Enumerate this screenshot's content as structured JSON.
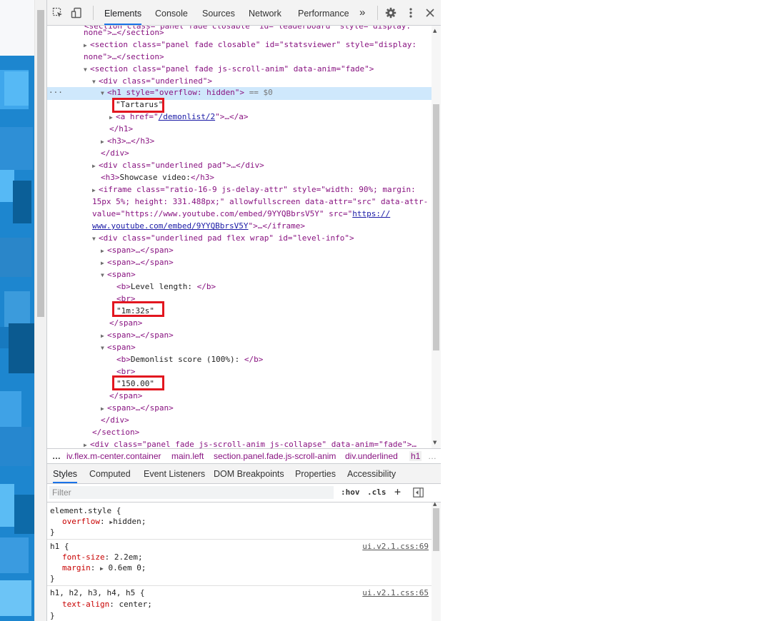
{
  "toolbar": {
    "tabs": [
      {
        "label": "Elements"
      },
      {
        "label": "Console"
      },
      {
        "label": "Sources"
      },
      {
        "label": "Network"
      },
      {
        "label": "Performance"
      }
    ],
    "more_label": "»",
    "settings_icon": "gear-icon",
    "menu_icon": "vertical-dots-icon",
    "close_icon": "close-icon"
  },
  "tree": {
    "lines": [
      {
        "a": "none\">…</section>"
      },
      {
        "a": "<section class=\"panel fade closable\" id=\"statsviewer\" style=\"display:"
      },
      {
        "a": "none\">…</section>"
      },
      {
        "a": "<section class=\"panel fade js-scroll-anim\" data-anim=\"fade\">"
      },
      {
        "a": "<div class=\"underlined\">"
      },
      {
        "a": "<h1 style=\"overflow: hidden\">",
        "b": "== $0"
      },
      {
        "a": "\"Tartarus\""
      },
      {
        "a": "<a href=\"",
        "link": "/demonlist/2",
        "c": "\">…</a>"
      },
      {
        "a": "</h1>"
      },
      {
        "a": "<h3>…</h3>"
      },
      {
        "a": "</div>"
      },
      {
        "a": "<div class=\"underlined pad\">…</div>"
      },
      {
        "a": "<h3>",
        "t": "Showcase video:",
        "c": "</h3>"
      },
      {
        "a": "<iframe class=\"ratio-16-9 js-delay-attr\" style=\"width: 90%; margin:"
      },
      {
        "a": "15px 5%; height: 331.488px;\" allowfullscreen data-attr=\"src\" data-attr-"
      },
      {
        "a": "value=\"https://www.youtube.com/embed/9YYQBbrsV5Y\" src=\"",
        "link": "https://"
      },
      {
        "link": "www.youtube.com/embed/9YYQBbrsV5Y",
        "c": "\">…</iframe>"
      },
      {
        "a": "<div class=\"underlined pad flex wrap\" id=\"level-info\">"
      },
      {
        "a": "<span>…</span>"
      },
      {
        "a": "<span>…</span>"
      },
      {
        "a": "<span>"
      },
      {
        "a": "<b>",
        "t": "Level length: ",
        "c": "</b>"
      },
      {
        "a": "<br>"
      },
      {
        "a": "\"1m:32s\""
      },
      {
        "a": "</span>"
      },
      {
        "a": "<span>…</span>"
      },
      {
        "a": "<span>"
      },
      {
        "a": "<b>",
        "t": "Demonlist score (100%): ",
        "c": "</b>"
      },
      {
        "a": "<br>"
      },
      {
        "a": "\"150.00\""
      },
      {
        "a": "</span>"
      },
      {
        "a": "<span>…</span>"
      },
      {
        "a": "</div>"
      },
      {
        "a": "</section>"
      },
      {
        "a": "<div class=\"panel fade js-scroll-anim js-collapse\" data-anim=\"fade\">…"
      }
    ],
    "row_dots": "···"
  },
  "breadcrumbs": {
    "more": "…",
    "items": [
      "iv.flex.m-center.container",
      "main.left",
      "section.panel.fade.js-scroll-anim",
      "div.underlined",
      "h1"
    ],
    "trailing": "…"
  },
  "subtabs": [
    "Styles",
    "Computed",
    "Event Listeners",
    "DOM Breakpoints",
    "Properties",
    "Accessibility"
  ],
  "filter": {
    "placeholder": "Filter",
    "hov": ":hov",
    "cls": ".cls",
    "plus": "+"
  },
  "styles": {
    "rules": [
      {
        "selector": "element.style {",
        "props": [
          {
            "name": "overflow",
            "value": "hidden",
            "arrow": true
          }
        ],
        "close": "}",
        "source": ""
      },
      {
        "selector": "h1 {",
        "props": [
          {
            "name": "font-size",
            "value": "2.2em;"
          },
          {
            "name": "margin",
            "value": "0.6em 0;",
            "arrow": true
          }
        ],
        "close": "}",
        "source": "ui.v2.1.css:69"
      },
      {
        "selector": "h1, h2, h3, h4, h5 {",
        "props": [
          {
            "name": "text-align",
            "value": "center;"
          }
        ],
        "close": "}",
        "source": "ui.v2.1.css:65"
      }
    ]
  }
}
